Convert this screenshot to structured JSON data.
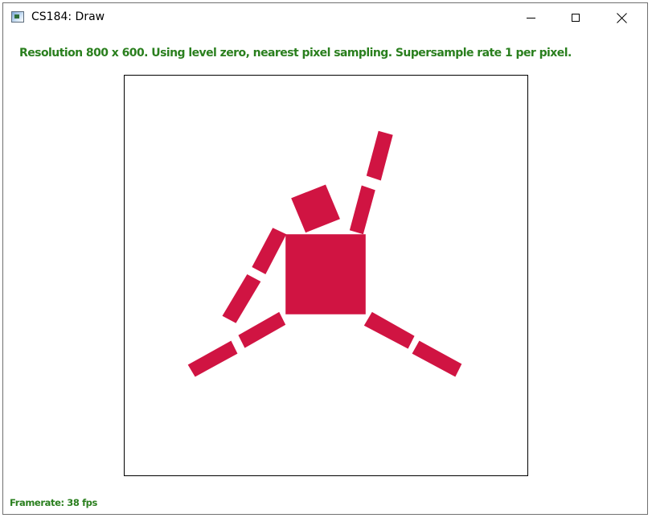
{
  "window": {
    "title": "CS184: Draw",
    "icon": "app-window-icon",
    "buttons": {
      "minimize": "minimize-icon",
      "maximize": "maximize-icon",
      "close": "close-icon"
    }
  },
  "hud": {
    "status": "Resolution 800 x 600. Using level zero, nearest pixel sampling. Supersample rate 1 per pixel.",
    "framerate": "Framerate: 38 fps",
    "text_color": "#2a7f1e"
  },
  "scene": {
    "fill_color": "#d01442",
    "border_color": "#000000",
    "shapes": [
      "body-square",
      "head-square",
      "left-upper-arm",
      "left-forearm",
      "right-upper-arm",
      "right-forearm",
      "left-thigh",
      "left-shin",
      "right-thigh",
      "right-shin"
    ]
  }
}
